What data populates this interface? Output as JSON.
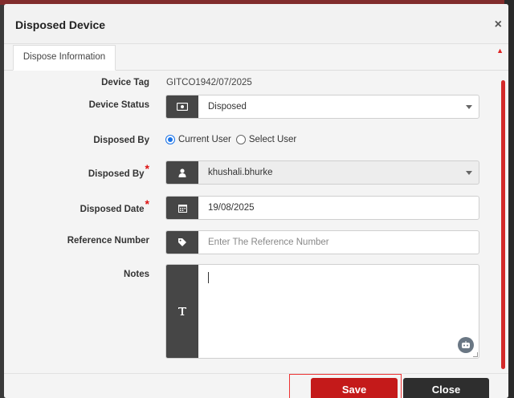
{
  "modal": {
    "title": "Disposed Device",
    "close_glyph": "×"
  },
  "tabs": [
    {
      "label": "Dispose Information",
      "active": true
    }
  ],
  "form": {
    "device_tag": {
      "label": "Device Tag",
      "value": "GITCO1942/07/2025"
    },
    "device_status": {
      "label": "Device Status",
      "value": "Disposed",
      "icon": "money-icon"
    },
    "disposed_by_mode": {
      "label": "Disposed By",
      "options": [
        {
          "label": "Current User",
          "selected": true
        },
        {
          "label": "Select User",
          "selected": false
        }
      ]
    },
    "disposed_by_user": {
      "label": "Disposed By",
      "required_mark": "*",
      "value": "khushali.bhurke",
      "icon": "user-icon"
    },
    "disposed_date": {
      "label": "Disposed Date",
      "required_mark": "*",
      "value": "19/08/2025",
      "icon": "calendar-icon"
    },
    "reference_number": {
      "label": "Reference Number",
      "placeholder": "Enter The Reference Number",
      "value": "",
      "icon": "tag-icon"
    },
    "notes": {
      "label": "Notes",
      "value": "",
      "icon": "text-icon"
    }
  },
  "footer": {
    "save_label": "Save",
    "close_label": "Close"
  },
  "colors": {
    "accent": "#c41a1a",
    "dark": "#2e2e2e",
    "addon": "#464646",
    "radio": "#1a73e8"
  }
}
